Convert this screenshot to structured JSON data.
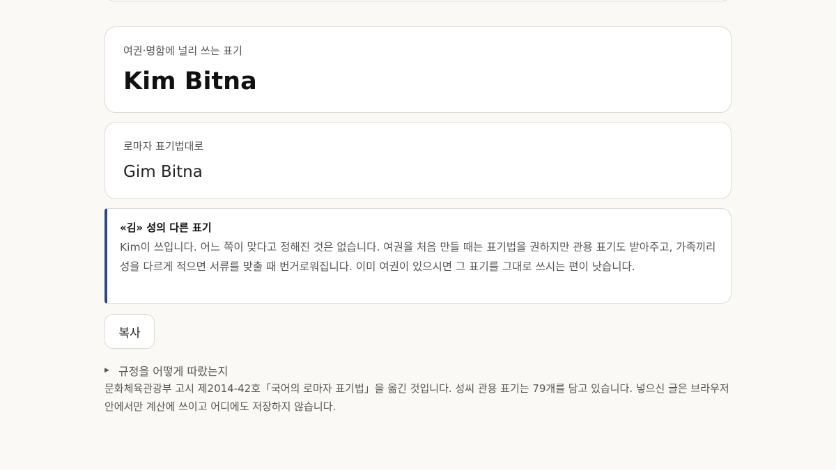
{
  "cards": {
    "common": {
      "label": "여권·명함에 널리 쓰는 표기",
      "value": "Kim Bitna"
    },
    "standard": {
      "label": "로마자 표기법대로",
      "value": "Gim Bitna"
    }
  },
  "note": {
    "title": "«김» 성의 다른 표기",
    "body": "Kim이 쓰입니다. 어느 쪽이 맞다고 정해진 것은 없습니다. 여권을 처음 만들 때는 표기법을 권하지만 관용 표기도 받아주고, 가족끼리 성을 다르게 적으면 서류를 맞출 때 번거로워집니다. 이미 여권이 있으시면 그 표기를 그대로 쓰시는 편이 낫습니다.",
    "accent_color": "#2f4a77"
  },
  "actions": {
    "copy_label": "복사"
  },
  "details": {
    "summary": "규정을 어떻게 따랐는지",
    "body": "문화체육관광부 고시 제2014-42호「국어의 로마자 표기법」을 옮긴 것입니다. 성씨 관용 표기는 79개를 담고 있습니다. 넣으신 글은 브라우저 안에서만 계산에 쓰이고 어디에도 저장하지 않습니다."
  }
}
